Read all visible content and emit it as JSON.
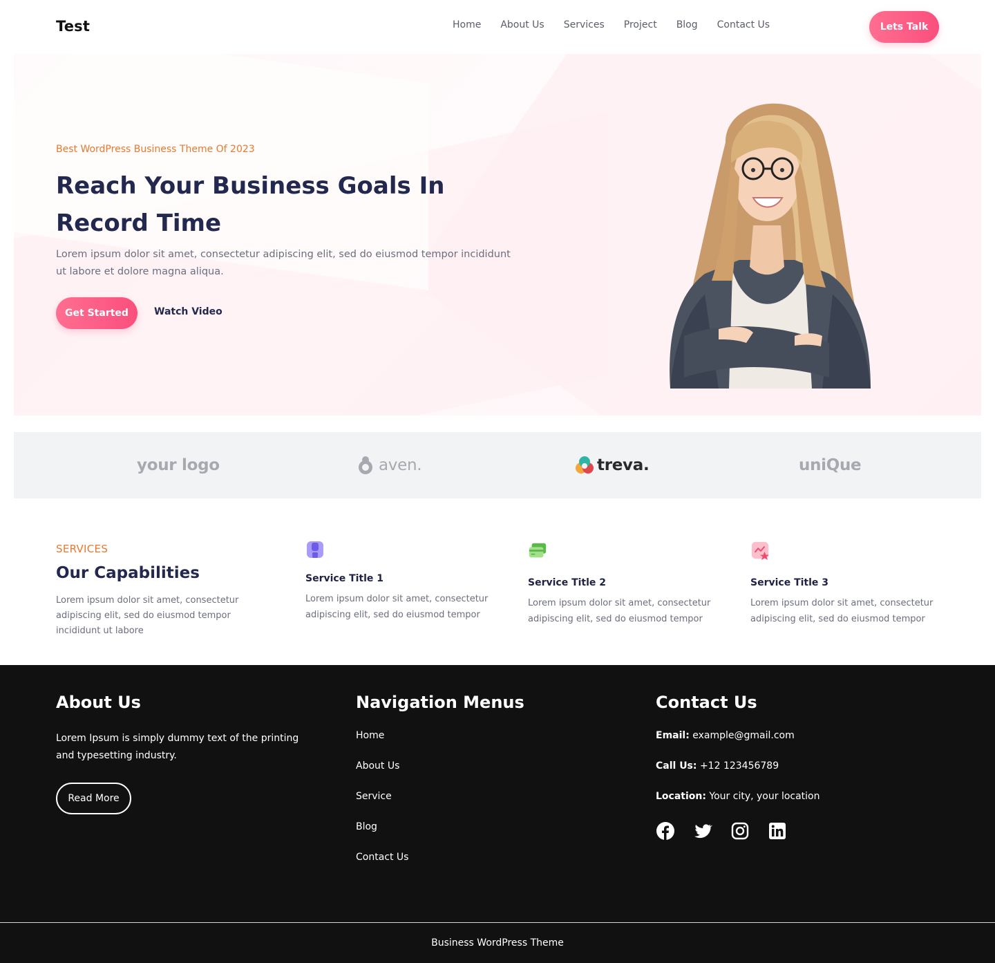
{
  "header": {
    "brand": "Test",
    "nav": [
      "Home",
      "About Us",
      "Services",
      "Project",
      "Blog",
      "Contact Us"
    ],
    "cta": "Lets Talk"
  },
  "hero": {
    "tag": "Best WordPress Business Theme Of 2023",
    "title": "Reach Your Business Goals In Record Time",
    "text": "Lorem ipsum dolor sit amet, consectetur adipiscing elit, sed do eiusmod tempor incididunt ut labore et dolore magna aliqua.",
    "primary_button": "Get Started",
    "secondary_button": "Watch Video"
  },
  "logos": [
    {
      "name": "your logo",
      "label": "your logo"
    },
    {
      "name": "aven",
      "label": "aven."
    },
    {
      "name": "treva",
      "label": "treva."
    },
    {
      "name": "unique",
      "label": "uniQue"
    }
  ],
  "services": {
    "label": "SERVICES",
    "title": "Our Capabilities",
    "text": "Lorem ipsum dolor sit amet, consectetur adipiscing elit, sed do eiusmod tempor incididunt ut labore",
    "cards": [
      {
        "title": "Service Title 1",
        "text": "Lorem ipsum dolor sit amet, consectetur adipiscing elit, sed do eiusmod tempor",
        "icon": "store-icon",
        "color": "#8b7cf6"
      },
      {
        "title": "Service Title 2",
        "text": "Lorem ipsum dolor sit amet, consectetur adipiscing elit, sed do eiusmod tempor",
        "icon": "credit-card-icon",
        "color": "#8cd96b"
      },
      {
        "title": "Service Title 3",
        "text": "Lorem ipsum dolor sit amet, consectetur adipiscing elit, sed do eiusmod tempor",
        "icon": "chart-star-icon",
        "color": "#f7a2b6"
      }
    ]
  },
  "footer": {
    "about": {
      "heading": "About Us",
      "text": "Lorem Ipsum is simply dummy text of the printing and typesetting industry.",
      "button": "Read More"
    },
    "nav": {
      "heading": "Navigation Menus",
      "items": [
        "Home",
        "About Us",
        "Service",
        "Blog",
        "Contact Us"
      ]
    },
    "contact": {
      "heading": "Contact Us",
      "email_label": "Email:",
      "email": "example@gmail.com",
      "call_label": "Call Us:",
      "call": "+12 123456789",
      "location_label": "Location:",
      "location": "Your city, your location",
      "socials": [
        "facebook-icon",
        "twitter-icon",
        "instagram-icon",
        "linkedin-icon"
      ]
    },
    "copyright": "Business WordPress Theme"
  },
  "colors": {
    "accent": "#fa4f7d",
    "orange": "#e8792e",
    "navy": "#22284e",
    "footer_bg": "#111111"
  }
}
